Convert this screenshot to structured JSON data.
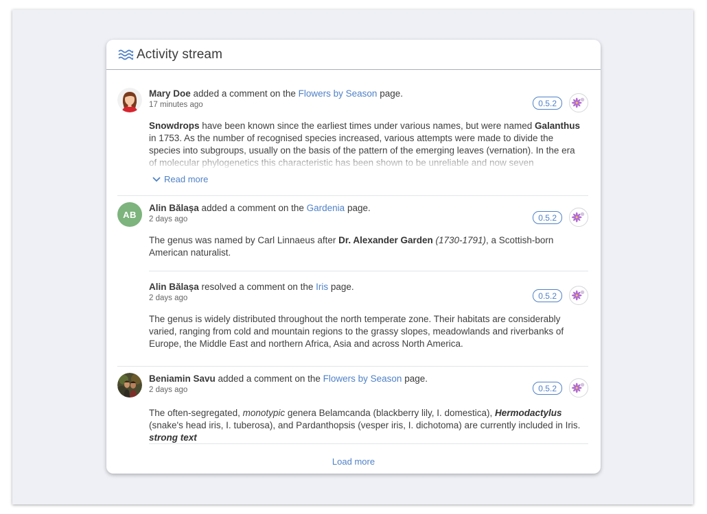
{
  "panel": {
    "title": "Activity stream",
    "icon": "waves-icon"
  },
  "entries": [
    {
      "author": "Mary Doe",
      "action": " added a comment on the ",
      "link": "Flowers by Season",
      "suffix": " page.",
      "time": "17 minutes ago",
      "version": "0.5.2",
      "body": {
        "b1": "Snowdrops",
        "t1": " have been known since the earliest times under various names, but were named ",
        "b2": "Galanthus",
        "t2": " in 1753. As the number of recognised species increased, various attempts were made to divide the species into subgroups, usually on the basis of the pattern of the emerging leaves (vernation). In the era of molecular phylogenetics this characteristic has been shown to be unreliable and now seven molecularly-defined clades"
      },
      "read_more": "Read more"
    },
    {
      "author": "Alin Bălașa",
      "initials": "AB",
      "action": " added a comment on the ",
      "link": "Gardenia",
      "suffix": " page.",
      "time": "2 days ago",
      "version": "0.5.2",
      "body": {
        "t1": "The genus was named by Carl Linnaeus after ",
        "b1": "Dr. Alexander Garden",
        "i1": " (1730-1791)",
        "t2": ", a Scottish-born American naturalist."
      }
    },
    {
      "author": "Alin Bălașa",
      "action": " resolved a comment on the ",
      "link": "Iris",
      "suffix": " page.",
      "time": "2 days ago",
      "version": "0.5.2",
      "body": {
        "t1": "The genus is widely distributed throughout the north temperate zone. Their habitats are considerably varied, ranging from cold and mountain regions to the grassy slopes, meadowlands and riverbanks of Europe, the Middle East and northern Africa, Asia and across North America."
      }
    },
    {
      "author": "Beniamin Savu",
      "action": " added a comment on the ",
      "link": "Flowers by Season",
      "suffix": " page.",
      "time": "2 days ago",
      "version": "0.5.2",
      "body": {
        "t1": "The often-segregated, ",
        "i1": "monotypic",
        "t2": " genera Belamcanda (blackberry lily, I. domestica), ",
        "bi1": "Hermodactylus",
        "t3": " (snake's head iris, I. tuberosa), and Pardanthopsis (vesper iris, I. dichotoma) are currently included in Iris. ",
        "bi2": "strong text"
      }
    }
  ],
  "load_more": "Load more",
  "colors": {
    "accent": "#4f81c7",
    "avatar_green": "#7db37d",
    "background": "#eef0f5"
  }
}
